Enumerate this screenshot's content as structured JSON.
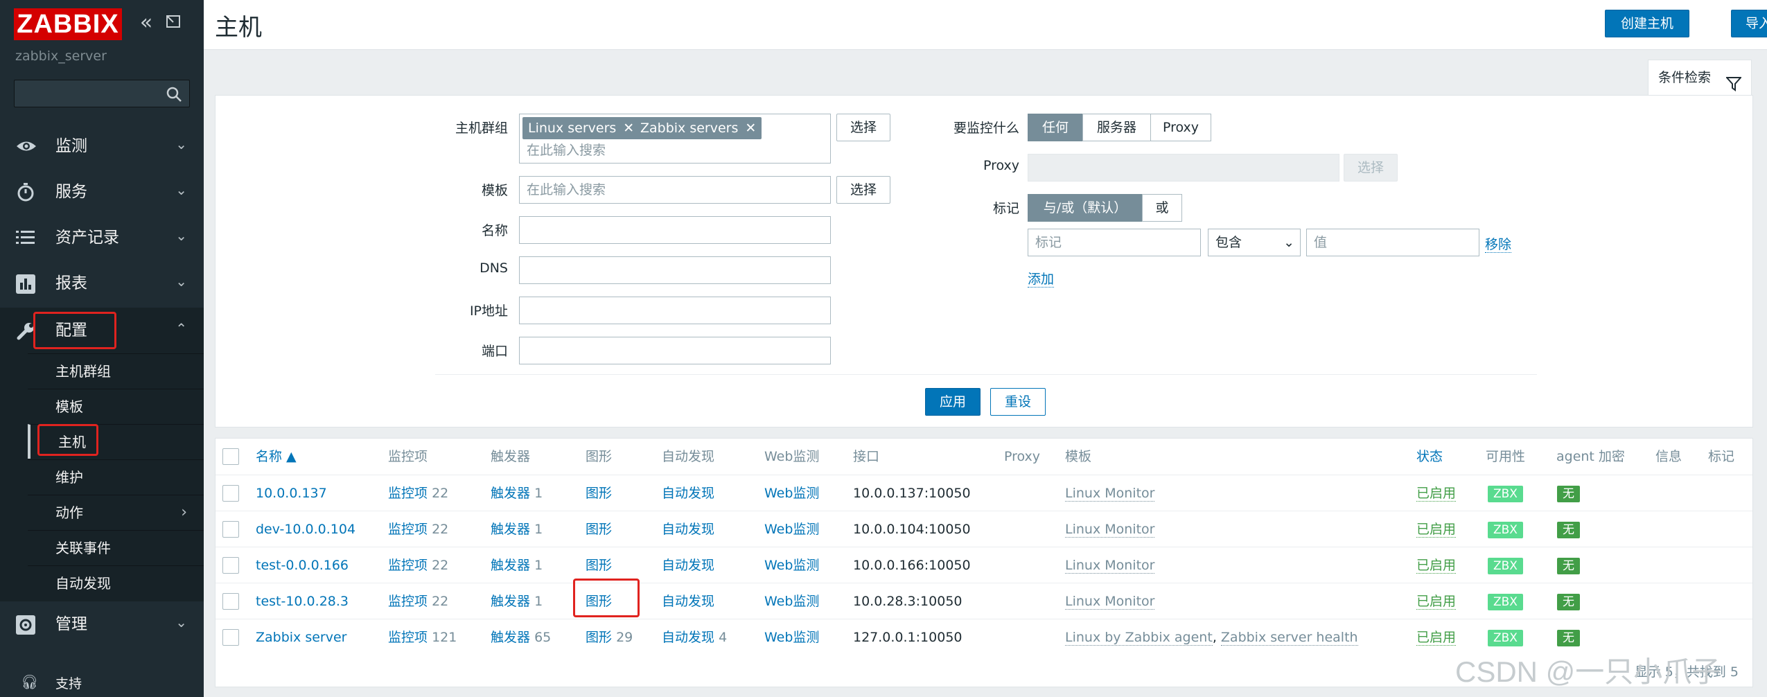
{
  "sidebar": {
    "logo": "ZABBIX",
    "server_name": "zabbix_server",
    "search_placeholder": "",
    "menu": [
      {
        "label": "监测",
        "icon": "eye-icon"
      },
      {
        "label": "服务",
        "icon": "clock-icon"
      },
      {
        "label": "资产记录",
        "icon": "list-icon"
      },
      {
        "label": "报表",
        "icon": "bar-chart-icon"
      },
      {
        "label": "配置",
        "icon": "wrench-icon"
      },
      {
        "label": "管理",
        "icon": "gear-icon"
      }
    ],
    "submenu": [
      "主机群组",
      "模板",
      "主机",
      "维护",
      "动作",
      "关联事件",
      "自动发现"
    ],
    "support": "支持"
  },
  "header": {
    "title": "主机",
    "create_host": "创建主机",
    "import": "导入"
  },
  "filter": {
    "tab_label": "条件检索",
    "host_groups_label": "主机群组",
    "chips": [
      "Linux servers",
      "Zabbix servers"
    ],
    "search_placeholder": "在此输入搜索",
    "select": "选择",
    "templates_label": "模板",
    "name_label": "名称",
    "dns_label": "DNS",
    "ip_label": "IP地址",
    "port_label": "端口",
    "monitored_by_label": "要监控什么",
    "monitored_by_options": [
      "任何",
      "服务器",
      "Proxy"
    ],
    "proxy_label": "Proxy",
    "tags_label": "标记",
    "tag_mode_options": [
      "与/或（默认）",
      "或"
    ],
    "tag_placeholder": "标记",
    "tag_operator": "包含",
    "tag_value_placeholder": "值",
    "remove": "移除",
    "add": "添加",
    "apply": "应用",
    "reset": "重设"
  },
  "table": {
    "headers": {
      "name": "名称 ▲",
      "items": "监控项",
      "triggers": "触发器",
      "graphs": "图形",
      "discovery": "自动发现",
      "web": "Web监测",
      "interface": "接口",
      "proxy": "Proxy",
      "templates": "模板",
      "status": "状态",
      "availability": "可用性",
      "encryption": "agent 加密",
      "info": "信息",
      "tags": "标记"
    },
    "rows": [
      {
        "name": "10.0.0.137",
        "items": "监控项",
        "items_count": "22",
        "triggers": "触发器",
        "triggers_count": "1",
        "graphs": "图形",
        "graphs_count": "",
        "discovery": "自动发现",
        "discovery_count": "",
        "web": "Web监测",
        "interface": "10.0.0.137:10050",
        "templates": "Linux Monitor",
        "templates2": "",
        "status": "已启用",
        "availability": "ZBX",
        "encryption": "无"
      },
      {
        "name": "dev-10.0.0.104",
        "items": "监控项",
        "items_count": "22",
        "triggers": "触发器",
        "triggers_count": "1",
        "graphs": "图形",
        "graphs_count": "",
        "discovery": "自动发现",
        "discovery_count": "",
        "web": "Web监测",
        "interface": "10.0.0.104:10050",
        "templates": "Linux Monitor",
        "templates2": "",
        "status": "已启用",
        "availability": "ZBX",
        "encryption": "无"
      },
      {
        "name": "test-0.0.0.166",
        "items": "监控项",
        "items_count": "22",
        "triggers": "触发器",
        "triggers_count": "1",
        "graphs": "图形",
        "graphs_count": "",
        "discovery": "自动发现",
        "discovery_count": "",
        "web": "Web监测",
        "interface": "10.0.0.166:10050",
        "templates": "Linux Monitor",
        "templates2": "",
        "status": "已启用",
        "availability": "ZBX",
        "encryption": "无"
      },
      {
        "name": "test-10.0.28.3",
        "items": "监控项",
        "items_count": "22",
        "triggers": "触发器",
        "triggers_count": "1",
        "graphs": "图形",
        "graphs_count": "",
        "discovery": "自动发现",
        "discovery_count": "",
        "web": "Web监测",
        "interface": "10.0.28.3:10050",
        "templates": "Linux Monitor",
        "templates2": "",
        "status": "已启用",
        "availability": "ZBX",
        "encryption": "无"
      },
      {
        "name": "Zabbix server",
        "items": "监控项",
        "items_count": "121",
        "triggers": "触发器",
        "triggers_count": "65",
        "graphs": "图形",
        "graphs_count": "29",
        "discovery": "自动发现",
        "discovery_count": "4",
        "web": "Web监测",
        "interface": "127.0.0.1:10050",
        "templates": "Linux by Zabbix agent",
        "templates2": "Zabbix server health",
        "status": "已启用",
        "availability": "ZBX",
        "encryption": "无"
      }
    ],
    "footer": "显示 5，共找到 5"
  },
  "watermark": "CSDN @一只小爪子",
  "colors": {
    "sidebar": "#1f2c33",
    "accent": "#0275b8",
    "brand": "#d40000",
    "highlight": "#e0231f",
    "enabled": "#429e47"
  }
}
